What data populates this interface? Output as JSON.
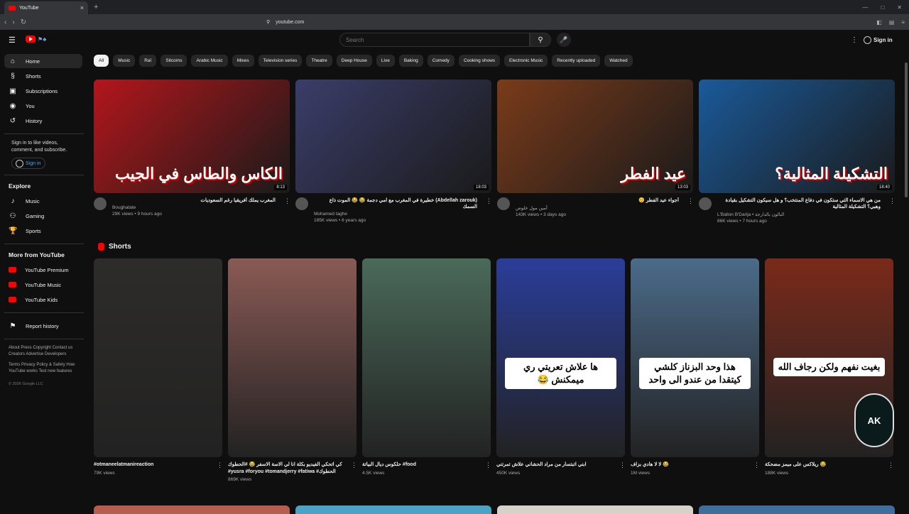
{
  "browser": {
    "tab_title": "YouTube",
    "new_tab": "+",
    "url": "youtube.com"
  },
  "masthead": {
    "search_placeholder": "Search",
    "signin": "Sign in"
  },
  "sidebar": {
    "main": [
      {
        "label": "Home",
        "icon": "home-icon"
      },
      {
        "label": "Shorts",
        "icon": "shorts-icon"
      },
      {
        "label": "Subscriptions",
        "icon": "subscriptions-icon"
      }
    ],
    "you": [
      {
        "label": "You",
        "icon": "you-icon"
      },
      {
        "label": "History",
        "icon": "history-icon"
      }
    ],
    "signin_prompt": "Sign in to like videos, comment, and subscribe.",
    "signin_button": "Sign in",
    "explore_title": "Explore",
    "explore": [
      {
        "label": "Music",
        "icon": "music-icon"
      },
      {
        "label": "Gaming",
        "icon": "gaming-icon"
      },
      {
        "label": "Sports",
        "icon": "sports-icon"
      }
    ],
    "more_title": "More from YouTube",
    "more": [
      {
        "label": "YouTube Premium"
      },
      {
        "label": "YouTube Music"
      },
      {
        "label": "YouTube Kids"
      }
    ],
    "report": "Report history",
    "footer1": "About Press Copyright Contact us Creators Advertise Developers",
    "footer2": "Terms Privacy Policy & Safety How YouTube works Test new features",
    "copyright": "© 2026 Google LLC"
  },
  "chips": [
    "All",
    "Music",
    "Raï",
    "Sitcoms",
    "Arabic Music",
    "Mixes",
    "Television series",
    "Theatre",
    "Deep House",
    "Live",
    "Baking",
    "Comedy",
    "Cooking shows",
    "Electronic Music",
    "Recently uploaded",
    "Watched"
  ],
  "videos": [
    {
      "title": "المغرب يملك أفريقيا رغم السعوديات",
      "channel": "Boughatate",
      "stats": "29K views • 9 hours ago",
      "duration": "8:13",
      "art": "الكاس والطاس في الجيب",
      "color": "#b3161b"
    },
    {
      "title": "(Abdellah zarouk) خطيرة في المغرب مع امي دجمة 😂 😂 الموت ذاع السمك",
      "channel": "Mohamed taghe",
      "stats": "185K views • 6 years ago",
      "duration": "18:03",
      "art": "",
      "color": "#3b3d6a"
    },
    {
      "title": "أجواء عيد الفطر 😊",
      "channel": "أمين مول خلوص",
      "stats": "143K views • 3 days ago",
      "duration": "13:03",
      "art": "عيد الفطر",
      "color": "#7a3b1a"
    },
    {
      "title": "من هي الاسماء التي ستكون في دفاع المنتخب؟ و هل سيكون التشكيل بقيادة وهبي؟ التشكيلة المثالية",
      "channel": "L'Ballon B'Darija • البالون بالدارجة",
      "stats": "86K views • 7 hours ago",
      "duration": "18:40",
      "art": "التشكيلة المثالية؟",
      "color": "#1a5a9a"
    }
  ],
  "shorts_title": "Shorts",
  "shorts": [
    {
      "title": "#otmaneelatmanireaction",
      "views": "79K views",
      "overlay": "",
      "color": "#2d2c2a"
    },
    {
      "title": "كي اتحكي الفيديو بكلة انا لي الاسة الاسفر 😂 #الحطوك #yusra #foryou #tomandjerry #fatiwa #الحطوك",
      "views": "869K views",
      "overlay": "",
      "color": "#8a5a55"
    },
    {
      "title": "حلكوس ديال البياتة #food",
      "views": "4.5K views",
      "overlay": "",
      "color": "#4a6a5a"
    },
    {
      "title": "ابني اتبتسار من مراد الحشاني علاش تمرتني",
      "views": "450K views",
      "overlay": "ها علاش تعريتي ري ميمكنش 😂",
      "color": "#2a3d9a"
    },
    {
      "title": "لا لا هادي بزاف 😂",
      "views": "1M views",
      "overlay": "هذا وحد البزناز كلشي كيتقدا من عندو الى واحد",
      "color": "#4b6b8a"
    },
    {
      "title": "ريلاكس على ميمز مضحكة 😂",
      "views": "188K views",
      "overlay": "بغيت نفهم ولكن رجاف الله",
      "color": "#7a2a1a"
    }
  ],
  "watermark": "AK"
}
